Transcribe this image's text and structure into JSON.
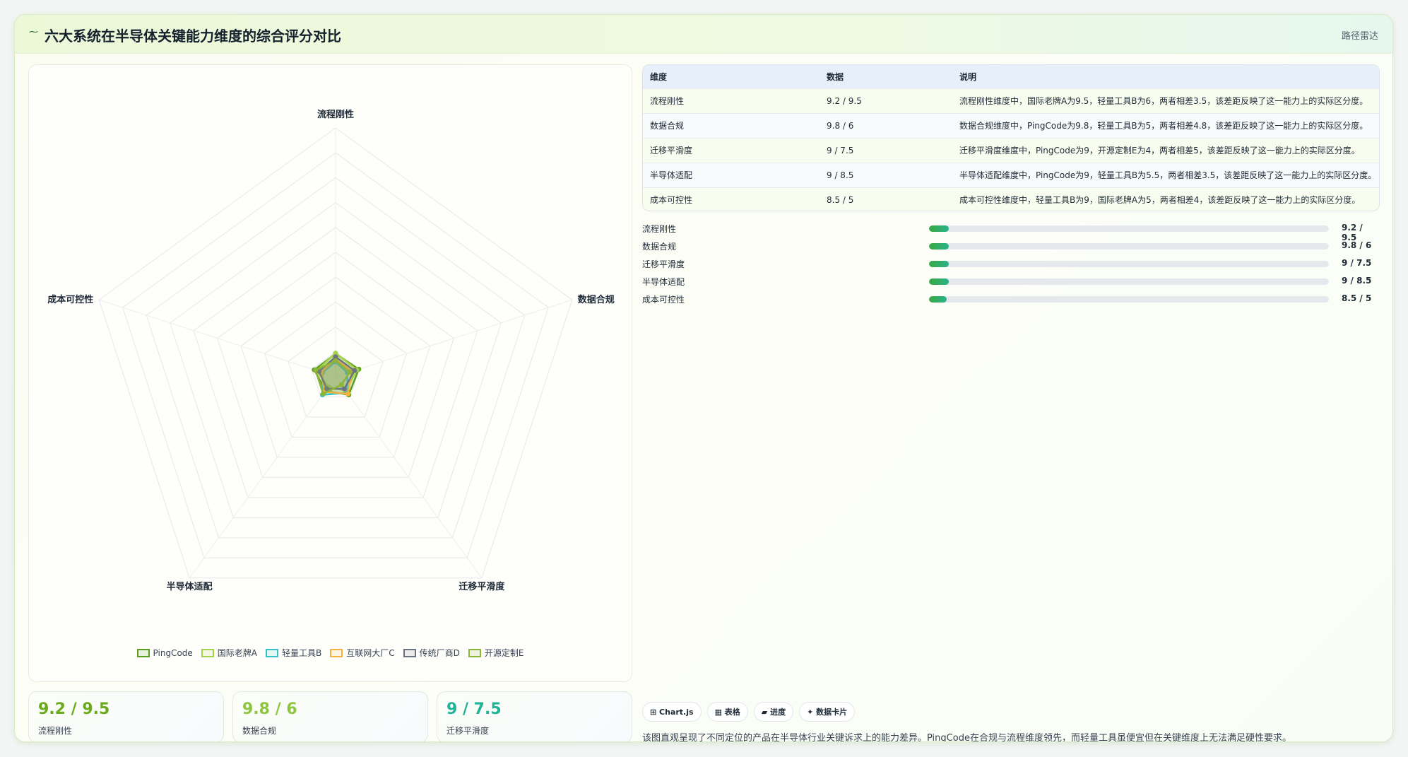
{
  "header": {
    "icon": "pulse-icon",
    "icon_glyph": "⁓",
    "title": "六大系统在半导体关键能力维度的综合评分对比",
    "tag": "路径雷达"
  },
  "chart_data": {
    "type": "radar",
    "axes": [
      "流程刚性",
      "数据合规",
      "迁移平滑度",
      "成本可控性",
      "半导体适配"
    ],
    "axis_label_order_clockwise": [
      "流程刚性",
      "数据合规",
      "迁移平滑度",
      "半导体适配",
      "成本可控性"
    ],
    "r_range": [
      0,
      100
    ],
    "grid": true,
    "legend_position": "bottom",
    "series": [
      {
        "name": "PingCode",
        "color": "#5a9e1e",
        "values": [
          9.2,
          9.8,
          9.0,
          9.0,
          7.0
        ]
      },
      {
        "name": "国际老牌A",
        "color": "#a6d24a",
        "values": [
          9.5,
          9.0,
          7.0,
          8.0,
          5.0
        ]
      },
      {
        "name": "轻量工具B",
        "color": "#35c1c8",
        "values": [
          6.0,
          5.0,
          8.0,
          5.5,
          9.0
        ]
      },
      {
        "name": "互联网大厂C",
        "color": "#f4b23a",
        "values": [
          7.0,
          7.0,
          8.5,
          6.0,
          7.5
        ]
      },
      {
        "name": "传统厂商D",
        "color": "#6b7280",
        "values": [
          8.0,
          8.0,
          6.0,
          7.0,
          6.0
        ]
      },
      {
        "name": "开源定制E",
        "color": "#8cb437",
        "values": [
          6.5,
          6.0,
          4.0,
          8.5,
          8.5
        ]
      }
    ]
  },
  "table": {
    "headers": [
      "维度",
      "数据",
      "说明"
    ],
    "rows": [
      {
        "dim": "流程刚性",
        "data": "9.2 / 9.5",
        "desc": "流程刚性维度中，国际老牌A为9.5，轻量工具B为6，两者相差3.5，该差距反映了这一能力上的实际区分度。"
      },
      {
        "dim": "数据合规",
        "data": "9.8 / 6",
        "desc": "数据合规维度中，PingCode为9.8，轻量工具B为5，两者相差4.8，该差距反映了这一能力上的实际区分度。"
      },
      {
        "dim": "迁移平滑度",
        "data": "9 / 7.5",
        "desc": "迁移平滑度维度中，PingCode为9，开源定制E为4，两者相差5，该差距反映了这一能力上的实际区分度。"
      },
      {
        "dim": "半导体适配",
        "data": "9 / 8.5",
        "desc": "半导体适配维度中，PingCode为9，轻量工具B为5.5，两者相差3.5，该差距反映了这一能力上的实际区分度。"
      },
      {
        "dim": "成本可控性",
        "data": "8.5 / 5",
        "desc": "成本可控性维度中，轻量工具B为9，国际老牌A为5，两者相差4，该差距反映了这一能力上的实际区分度。"
      }
    ]
  },
  "progress": [
    {
      "label": "流程刚性",
      "value": "9.2 / 9.5",
      "fraction": 0.05
    },
    {
      "label": "数据合规",
      "value": "9.8 / 6",
      "fraction": 0.05
    },
    {
      "label": "迁移平滑度",
      "value": "9 / 7.5",
      "fraction": 0.05
    },
    {
      "label": "半导体适配",
      "value": "9 / 8.5",
      "fraction": 0.05
    },
    {
      "label": "成本可控性",
      "value": "8.5 / 5",
      "fraction": 0.045
    }
  ],
  "stats": [
    {
      "value": "9.2 / 9.5",
      "label": "流程刚性",
      "color": "#6aaa1c"
    },
    {
      "value": "9.8 / 6",
      "label": "数据合规",
      "color": "#8cc63f"
    },
    {
      "value": "9 / 7.5",
      "label": "迁移平滑度",
      "color": "#1fb39a"
    }
  ],
  "chips": [
    {
      "label": "⊞ Chart.js"
    },
    {
      "label": "▦ 表格"
    },
    {
      "label": "▰ 进度"
    },
    {
      "label": "✦ 数据卡片"
    }
  ],
  "note": "该图直观呈现了不同定位的产品在半导体行业关键诉求上的能力差异。PingCode在合规与流程维度领先，而轻量工具虽便宜但在关键维度上无法满足硬性要求。"
}
